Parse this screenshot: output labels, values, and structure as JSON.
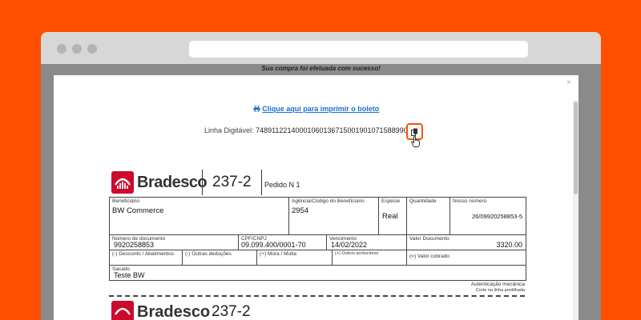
{
  "page": {
    "success_message": "Sua compra foi efetuada com sucesso!",
    "close_label": "×",
    "print_icon": "printer-icon",
    "print_label": "Clique aqui para imprimir o boleto",
    "linha_label": "Linha Digitável:",
    "linha_value": "74891122140001060136715001901071588990000",
    "copy_icon": "copy-icon",
    "cursor_icon": "hand-pointer-icon"
  },
  "boleto": {
    "bank_name": "Bradesco",
    "bank_code": "237-2",
    "pedido": "Pedido N 1",
    "beneficiario_label": "Beneficiário",
    "beneficiario_value": "BW Commerce",
    "agencia_label": "Agência/Código do Beneficiário",
    "agencia_value": "2954",
    "especie_label": "Espécie",
    "especie_value": "Real",
    "quantidade_label": "Quantidade",
    "nosso_numero_label": "Nosso número",
    "nosso_numero_value": "26/09920258853-5",
    "num_doc_label": "Número de documento",
    "num_doc_value": "9920258853",
    "cpf_label": "CPF/CNPJ",
    "cpf_value": "09.099.400/0001-70",
    "vencimento_label": "Vencimento",
    "vencimento_value": "14/02/2022",
    "valor_doc_label": "Valor Documento",
    "valor_doc_value": "3320.00",
    "desconto_label": "(-) Desconto / Abatimentos",
    "outras_deducoes_label": "(-) Outras deduções",
    "mora_label": "(+) Mora / Multa",
    "outros_acrescimos_label": "(+) Outros acréscimos",
    "valor_cobrado_label": "(=) Valor cobrado",
    "sacado_label": "Sacado",
    "sacado_value": "Teste BW",
    "autenticacao_label": "Autenticação mecânica",
    "corte_label": "Corte na linha pontilhada",
    "brand_color": "#cc092f"
  },
  "colors": {
    "background": "#fe5000",
    "link": "#1a6fd0"
  }
}
